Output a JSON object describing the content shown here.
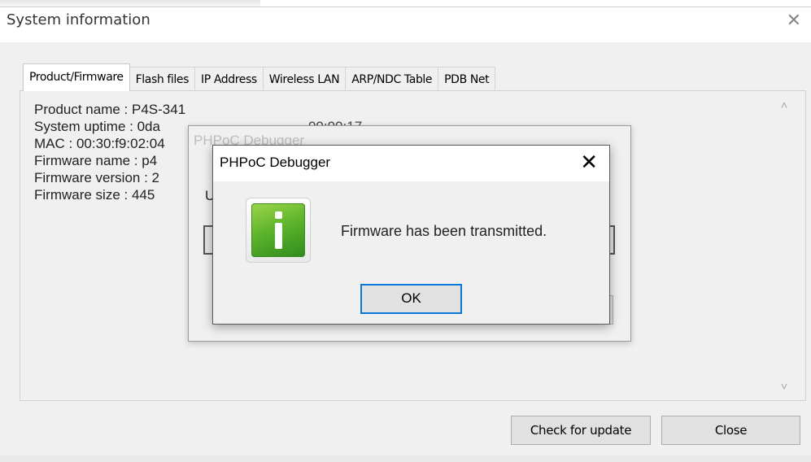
{
  "window": {
    "title": "System information",
    "close_glyph": "✕"
  },
  "tabs": [
    {
      "label": "Product/Firmware",
      "active": true
    },
    {
      "label": "Flash files",
      "active": false
    },
    {
      "label": "IP Address",
      "active": false
    },
    {
      "label": "Wireless LAN",
      "active": false
    },
    {
      "label": "ARP/NDC Table",
      "active": false
    },
    {
      "label": "PDB Net",
      "active": false
    }
  ],
  "info": {
    "lines": [
      "Product name : P4S-341",
      "System uptime : 0da",
      "MAC : 00:30:f9:02:04",
      "Firmware name : p4",
      "Firmware version : 2",
      "Firmware size : 445"
    ],
    "hidden_tail": "00:00:17"
  },
  "scrollbar": {
    "up_glyph": "˄",
    "down_glyph": "˅"
  },
  "background_dialog": {
    "title": "PHPoC Debugger",
    "label_fragment": "U"
  },
  "dialog": {
    "title": "PHPoC Debugger",
    "close_glyph": "✕",
    "icon": "info-icon",
    "message": "Firmware has been transmitted.",
    "ok_label": "OK"
  },
  "buttons": {
    "check_update": "Check for update",
    "close": "Close"
  },
  "colors": {
    "focus_border": "#0a78d7",
    "icon_green": "#5fb52c",
    "window_bg": "#f0f0f0"
  }
}
